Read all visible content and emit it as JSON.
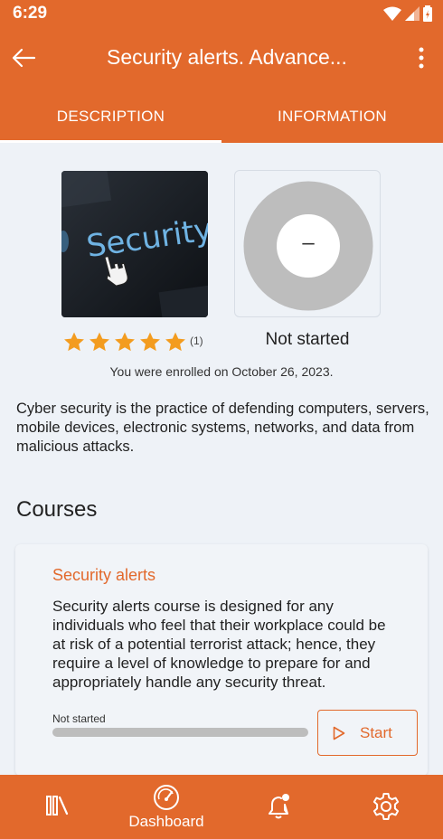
{
  "status_bar": {
    "time": "6:29"
  },
  "app_bar": {
    "title": "Security alerts. Advance..."
  },
  "tabs": [
    {
      "label": "DESCRIPTION",
      "selected": true
    },
    {
      "label": "INFORMATION",
      "selected": false
    }
  ],
  "thumbnail": {
    "text": "Security"
  },
  "progress": {
    "donut_label": "–",
    "status": "Not started",
    "value": 0
  },
  "rating": {
    "stars": 5,
    "count": "(1)"
  },
  "enrolled_text": "You were enrolled on October 26, 2023.",
  "description": "Cyber security is the practice of defending computers, servers, mobile devices, electronic systems, networks, and data from malicious attacks.",
  "courses_title": "Courses",
  "course": {
    "name": "Security alerts",
    "description": "Security alerts course is designed for any individuals who feel that their workplace could be at risk of a potential terrorist attack; hence, they require a level of knowledge to prepare for and appropriately handle any security threat.",
    "progress_label": "Not started",
    "progress_value": 0,
    "start_label": "Start"
  },
  "bottom_nav": {
    "library_icon": "library-icon",
    "dashboard_label": "Dashboard",
    "notifications_icon": "bell-icon",
    "settings_icon": "gear-icon"
  },
  "colors": {
    "accent": "#e2692c",
    "star": "#f39c1f",
    "background": "#eef2f7"
  }
}
